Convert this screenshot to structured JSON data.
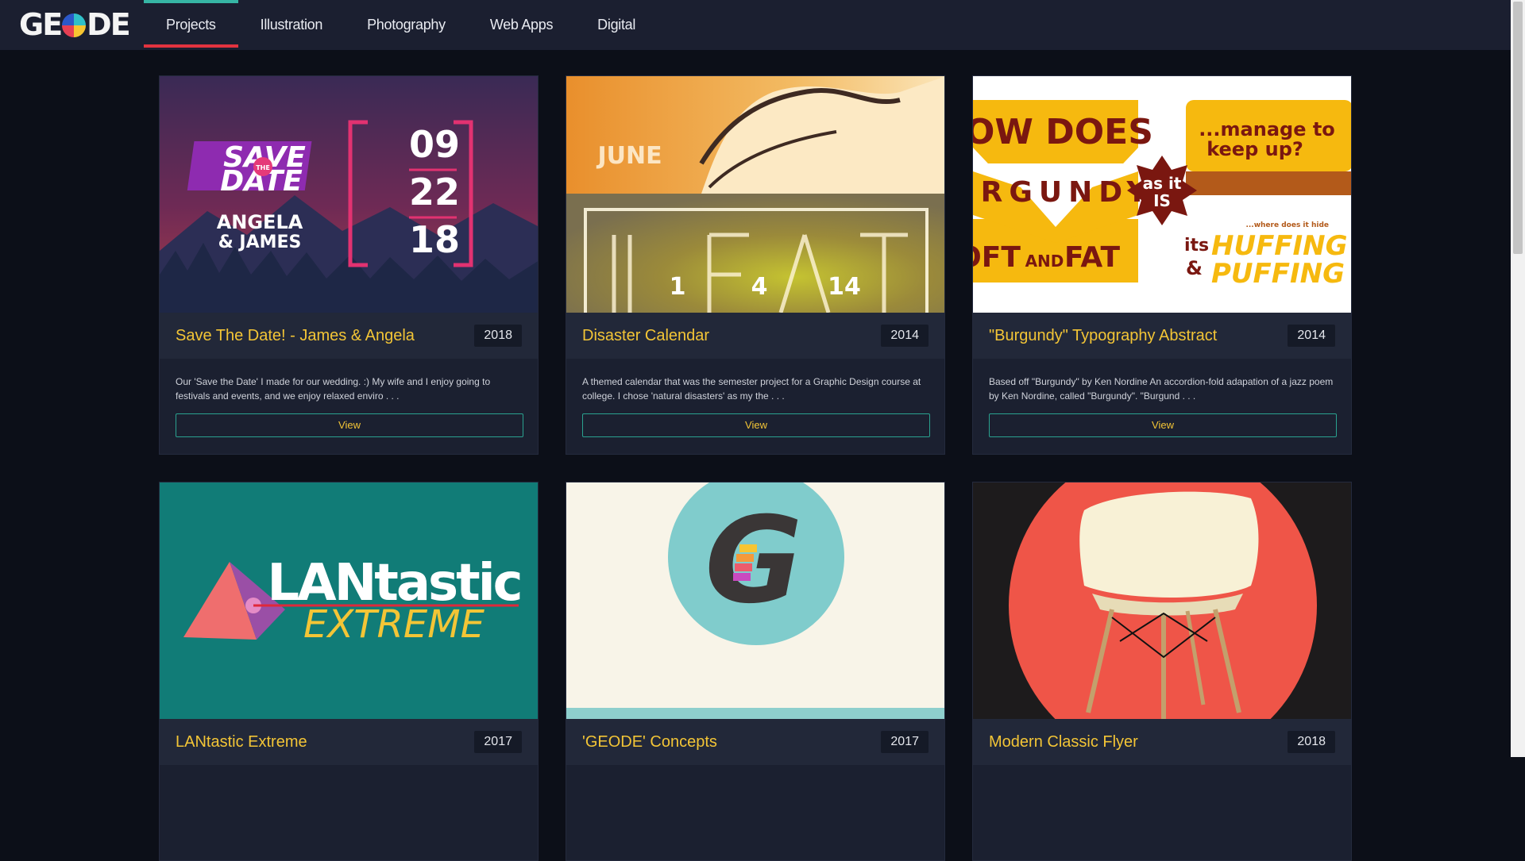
{
  "brand": {
    "logo_left": "GE",
    "logo_right": "DE"
  },
  "nav": {
    "tabs": [
      {
        "label": "Projects",
        "active": true
      },
      {
        "label": "Illustration",
        "active": false
      },
      {
        "label": "Photography",
        "active": false
      },
      {
        "label": "Web Apps",
        "active": false
      },
      {
        "label": "Digital",
        "active": false
      }
    ]
  },
  "colors": {
    "accent_title": "#f3c536",
    "tab_top": "#36b5a4",
    "tab_underline": "#e2333f",
    "view_border": "#2aa18f"
  },
  "cards": [
    {
      "title": "Save The Date! - James & Angela",
      "year": "2018",
      "description": "Our 'Save the Date' I made for our wedding. :) My wife and I enjoy going to festivals and events, and we enjoy relaxed enviro . . .",
      "button": "View",
      "art": {
        "save": "SAVE",
        "the": "THE",
        "date": "DATE",
        "names1": "ANGELA",
        "names2": "& JAMES",
        "d1": "09",
        "d2": "22",
        "d3": "18"
      }
    },
    {
      "title": "Disaster Calendar",
      "year": "2014",
      "description": "A themed calendar that was the semester project for a Graphic Design course at college. I chose 'natural disasters' as my the . . .",
      "button": "View",
      "art": {
        "month": "JUNE",
        "n1": "1",
        "n2": "4",
        "n3": "14"
      }
    },
    {
      "title": "\"Burgundy\" Typography Abstract",
      "year": "2014",
      "description": "Based off \"Burgundy\" by Ken Nordine An accordion-fold adapation of a jazz poem by Ken Nordine, called \"Burgundy\". \"Burgund . . .",
      "button": "View",
      "art": {
        "how": "HOW DOES",
        "burgundy": "URGUNDY",
        "soft": "OFT",
        "and": "AND",
        "fat": "FAT",
        "manage": "...manage to",
        "keepup": "keep up?",
        "asitis1": "as it",
        "asitis2": "IS",
        "where": "...where does it hide",
        "its": "its",
        "amp": "&",
        "huffing": "HUFFING",
        "puffing": "PUFFING"
      }
    },
    {
      "title": "LANtastic Extreme",
      "year": "2017",
      "art": {
        "lan": "LANtastic",
        "ext": "EXTREME"
      }
    },
    {
      "title": "'GEODE' Concepts",
      "year": "2017",
      "art": {
        "g": "G"
      }
    },
    {
      "title": "Modern Classic Flyer",
      "year": "2018"
    }
  ]
}
